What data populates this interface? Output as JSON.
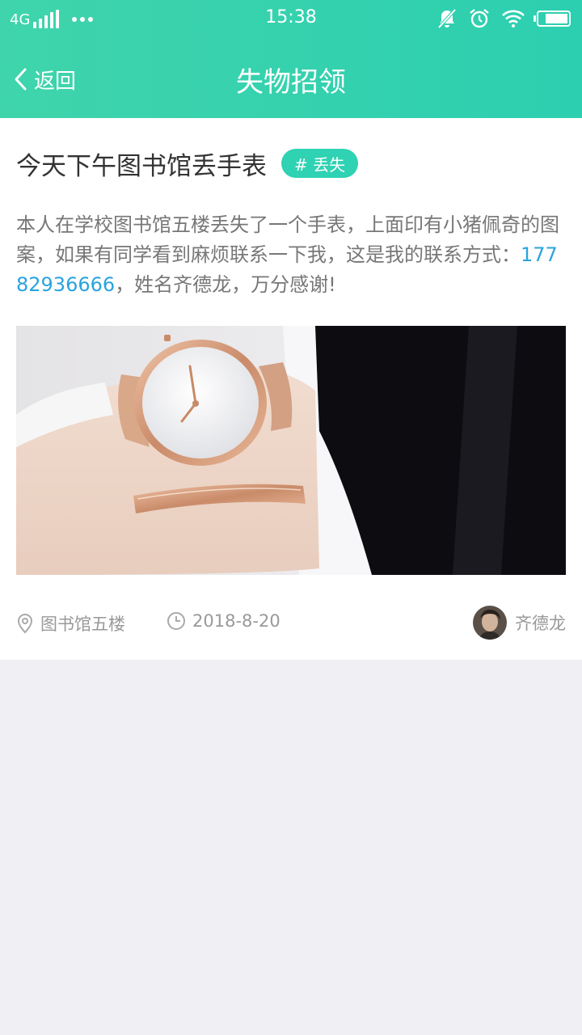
{
  "status_bar": {
    "network": "4G",
    "time": "15:38",
    "battery_level": 0.8,
    "icons": [
      "signal-icon",
      "more-dots-icon",
      "mute-icon",
      "alarm-icon",
      "wifi-icon",
      "battery-icon"
    ]
  },
  "nav": {
    "back_label": "返回",
    "title": "失物招领"
  },
  "post": {
    "title": "今天下午图书馆丢手表",
    "tag": "# 丢失",
    "body_before": "本人在学校图书馆五楼丢失了一个手表，上面印有小猪佩奇的图案，如果有同学看到麻烦联系一下我，这是我的联系方式：",
    "phone": "17782936666",
    "body_after": "，姓名齐德龙，万分感谢!",
    "location": "图书馆五楼",
    "date": "2018-8-20",
    "author": "齐德龙"
  },
  "colors": {
    "accent": "#2ccfb0",
    "link": "#29a3de",
    "text_primary": "#333333",
    "text_secondary": "#777777",
    "meta": "#999999",
    "page_bg": "#efeff4"
  }
}
